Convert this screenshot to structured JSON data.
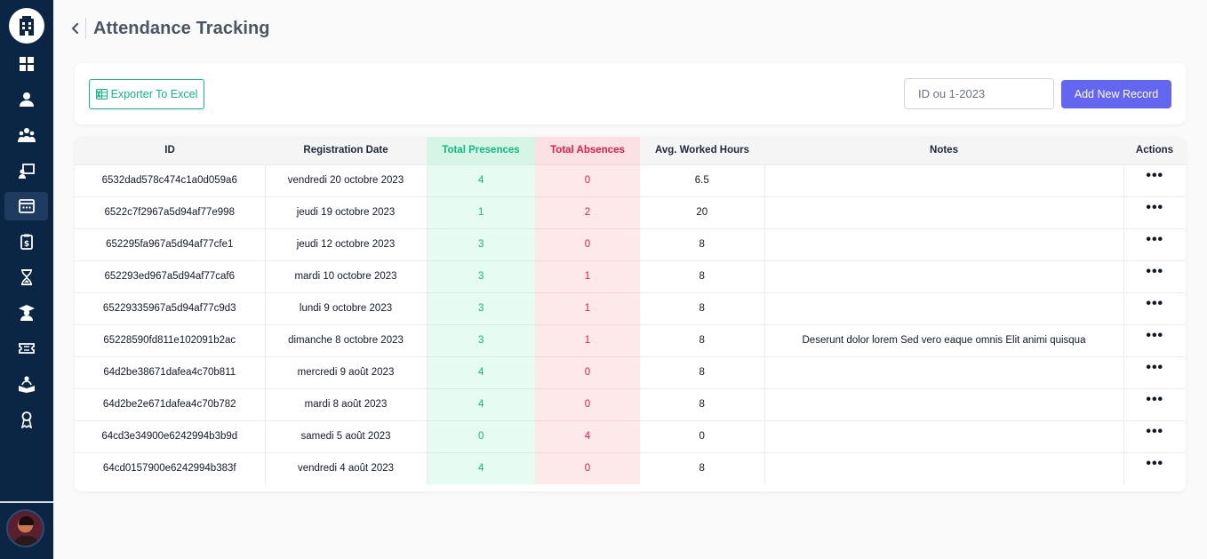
{
  "sidebar": {
    "icons": [
      "dashboard-icon",
      "employee-icon",
      "team-icon",
      "training-icon",
      "calendar-icon",
      "payroll-icon",
      "hourglass-icon",
      "graduate-icon",
      "ticket-icon",
      "reading-icon",
      "badge-icon"
    ],
    "active_index": 4
  },
  "header": {
    "title": "Attendance Tracking"
  },
  "toolbar": {
    "export_label": "Exporter To Excel",
    "search_placeholder": "ID ou 1-2023",
    "add_label": "Add New Record"
  },
  "colors": {
    "sidebar_bg": "#0b2545",
    "accent": "#6366f1",
    "presence": "#10b981",
    "absence": "#e11d48"
  },
  "table": {
    "headers": {
      "id": "ID",
      "date": "Registration Date",
      "presences": "Total Presences",
      "absences": "Total Absences",
      "hours": "Avg. Worked Hours",
      "notes": "Notes",
      "actions": "Actions"
    },
    "action_glyph": "•••",
    "rows": [
      {
        "id": "6532dad578c474c1a0d059a6",
        "date": "vendredi 20 octobre 2023",
        "presences": "4",
        "absences": "0",
        "hours": "6.5",
        "notes": ""
      },
      {
        "id": "6522c7f2967a5d94af77e998",
        "date": "jeudi 19 octobre 2023",
        "presences": "1",
        "absences": "2",
        "hours": "20",
        "notes": ""
      },
      {
        "id": "652295fa967a5d94af77cfe1",
        "date": "jeudi 12 octobre 2023",
        "presences": "3",
        "absences": "0",
        "hours": "8",
        "notes": ""
      },
      {
        "id": "652293ed967a5d94af77caf6",
        "date": "mardi 10 octobre 2023",
        "presences": "3",
        "absences": "1",
        "hours": "8",
        "notes": ""
      },
      {
        "id": "65229335967a5d94af77c9d3",
        "date": "lundi 9 octobre 2023",
        "presences": "3",
        "absences": "1",
        "hours": "8",
        "notes": ""
      },
      {
        "id": "65228590fd811e102091b2ac",
        "date": "dimanche 8 octobre 2023",
        "presences": "3",
        "absences": "1",
        "hours": "8",
        "notes": "Deserunt dolor lorem Sed vero eaque omnis Elit animi quisqua"
      },
      {
        "id": "64d2be38671dafea4c70b811",
        "date": "mercredi 9 août 2023",
        "presences": "4",
        "absences": "0",
        "hours": "8",
        "notes": ""
      },
      {
        "id": "64d2be2e671dafea4c70b782",
        "date": "mardi 8 août 2023",
        "presences": "4",
        "absences": "0",
        "hours": "8",
        "notes": ""
      },
      {
        "id": "64cd3e34900e6242994b3b9d",
        "date": "samedi 5 août 2023",
        "presences": "0",
        "absences": "4",
        "hours": "0",
        "notes": ""
      },
      {
        "id": "64cd0157900e6242994b383f",
        "date": "vendredi 4 août 2023",
        "presences": "4",
        "absences": "0",
        "hours": "8",
        "notes": ""
      }
    ]
  }
}
